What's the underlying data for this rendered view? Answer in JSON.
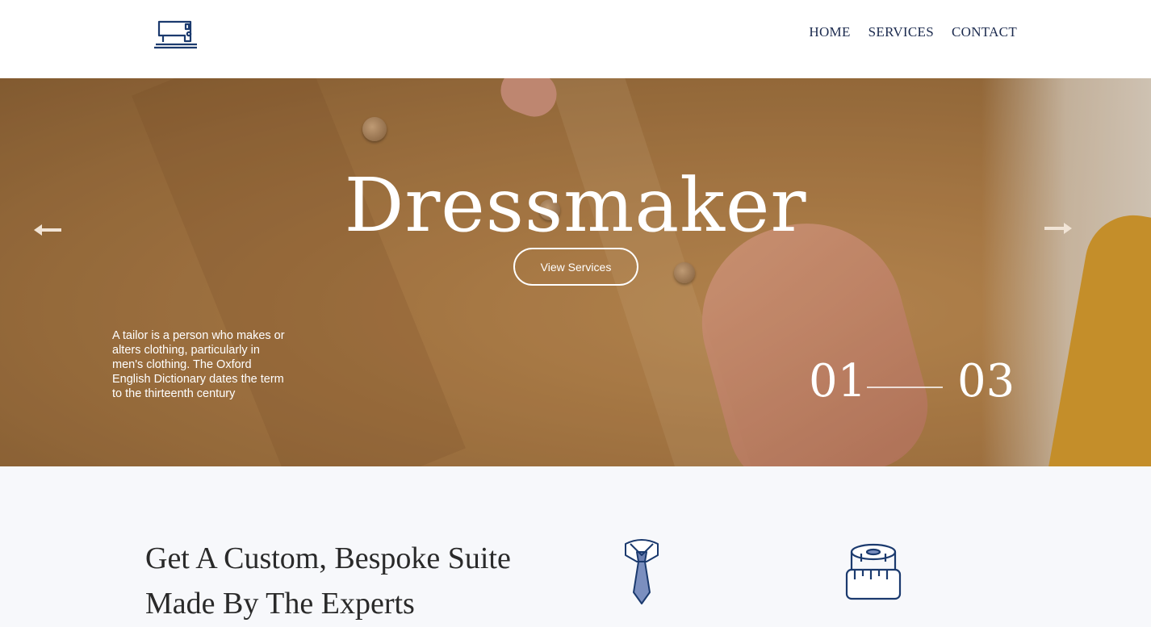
{
  "header": {
    "logo_icon": "sewing-machine-icon",
    "nav": [
      "HOME",
      "SERVICES",
      "CONTACT"
    ]
  },
  "hero": {
    "title": "Dressmaker",
    "button_label": "View Services",
    "description": "A tailor is a person who makes or alters clothing, particularly in men's clothing. The Oxford English Dictionary dates the term to the thirteenth century",
    "slide_current": "01",
    "slide_total": "03",
    "prev_icon": "arrow-left-icon",
    "next_icon": "arrow-right-icon"
  },
  "services_section": {
    "title": "Get A Custom, Bespoke Suite Made By The Experts",
    "icons": [
      "tie-icon",
      "measuring-tape-icon"
    ]
  },
  "colors": {
    "brand_navy": "#1b2a4e",
    "hero_tone": "#b8874e",
    "section_bg": "#f7f8fb"
  }
}
